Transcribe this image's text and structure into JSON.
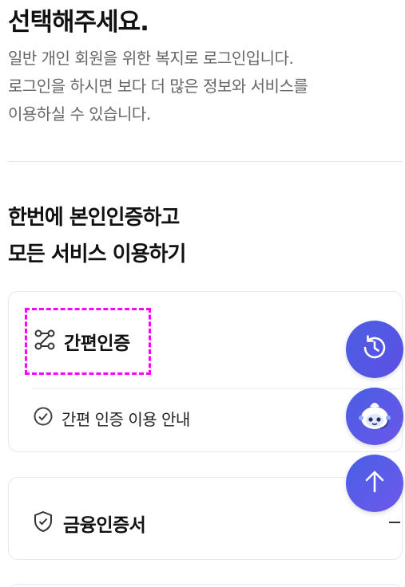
{
  "page": {
    "title": "선택해주세요.",
    "description_lines": [
      "일반 개인 회원을 위한 복지로 로그인입니다.",
      "로그인을 하시면 보다 더 많은 정보와 서비스를",
      "이용하실 수 있습니다."
    ],
    "heading_lines": [
      "한번에 본인인증하고",
      "모든 서비스 이용하기"
    ]
  },
  "cards": {
    "simple_auth": {
      "label": "간편인증",
      "icon": "route-icon",
      "guide_label": "간편 인증 이용 안내",
      "guide_icon": "check-circle-icon"
    },
    "financial_cert": {
      "label": "금융인증서",
      "icon": "shield-check-icon",
      "toggle_icon": "minus-icon"
    }
  },
  "floating": {
    "history_icon": "history-icon",
    "chatbot_icon": "chatbot-icon",
    "scroll_top_icon": "arrow-up-icon"
  },
  "colors": {
    "accent": "#5456e6",
    "highlight_dashed": "#ff00ff",
    "text_muted": "#666666"
  }
}
